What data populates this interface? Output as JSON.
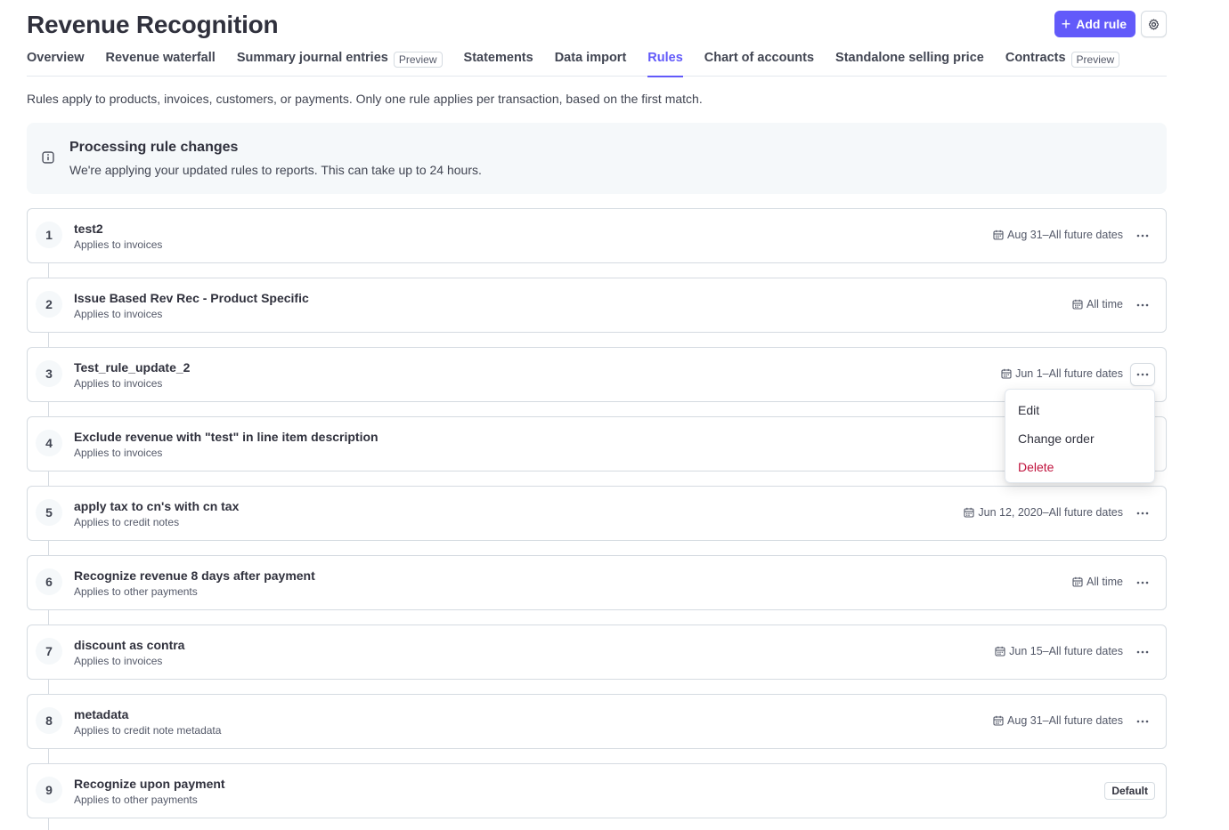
{
  "header": {
    "title": "Revenue Recognition",
    "add_rule_label": "Add rule"
  },
  "tabs": [
    {
      "label": "Overview",
      "badge": ""
    },
    {
      "label": "Revenue waterfall",
      "badge": ""
    },
    {
      "label": "Summary journal entries",
      "badge": "Preview"
    },
    {
      "label": "Statements",
      "badge": ""
    },
    {
      "label": "Data import",
      "badge": ""
    },
    {
      "label": "Rules",
      "badge": "",
      "active": true
    },
    {
      "label": "Chart of accounts",
      "badge": ""
    },
    {
      "label": "Standalone selling price",
      "badge": ""
    },
    {
      "label": "Contracts",
      "badge": "Preview"
    }
  ],
  "intro": "Rules apply to products, invoices, customers, or payments. Only one rule applies per transaction, based on the first match.",
  "banner": {
    "title": "Processing rule changes",
    "text": "We're applying your updated rules to reports. This can take up to 24 hours."
  },
  "rules": [
    {
      "num": "1",
      "name": "test2",
      "applies": "Applies to invoices",
      "dates": "Aug 31–All future dates"
    },
    {
      "num": "2",
      "name": "Issue Based Rev Rec - Product Specific",
      "applies": "Applies to invoices",
      "dates": "All time"
    },
    {
      "num": "3",
      "name": "Test_rule_update_2",
      "applies": "Applies to invoices",
      "dates": "Jun 1–All future dates"
    },
    {
      "num": "4",
      "name": "Exclude revenue with \"test\" in line item description",
      "applies": "Applies to invoices",
      "dates": ""
    },
    {
      "num": "5",
      "name": "apply tax to cn's with cn tax",
      "applies": "Applies to credit notes",
      "dates": "Jun 12, 2020–All future dates"
    },
    {
      "num": "6",
      "name": "Recognize revenue 8 days after payment",
      "applies": "Applies to other payments",
      "dates": "All time"
    },
    {
      "num": "7",
      "name": "discount as contra",
      "applies": "Applies to invoices",
      "dates": "Jun 15–All future dates"
    },
    {
      "num": "8",
      "name": "metadata",
      "applies": "Applies to credit note metadata",
      "dates": "Aug 31–All future dates"
    },
    {
      "num": "9",
      "name": "Recognize upon payment",
      "applies": "Applies to other payments",
      "dates": "",
      "badge": "Default"
    }
  ],
  "menu": {
    "items": [
      "Edit",
      "Change order",
      "Delete"
    ]
  },
  "colors": {
    "accent": "#625afa",
    "danger": "#c0123c",
    "border": "#d5dbe1",
    "banner_bg": "#f5f8fa"
  },
  "icons": {
    "add": "plus-icon",
    "settings": "gear-icon",
    "info": "info-icon",
    "date": "calendar-icon",
    "more": "ellipsis-icon"
  }
}
